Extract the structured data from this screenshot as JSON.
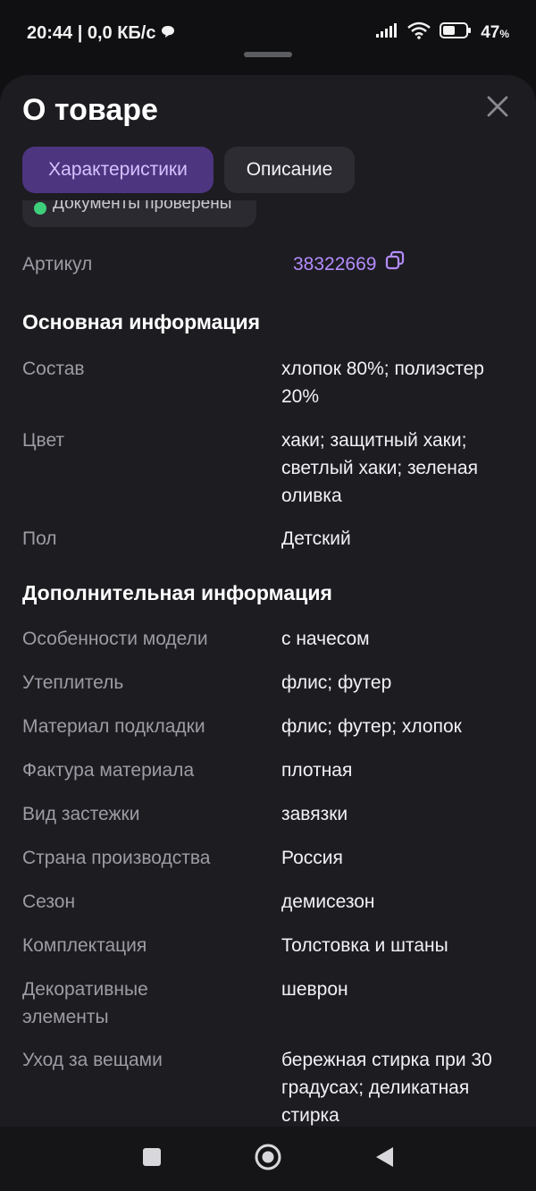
{
  "status_bar": {
    "time_speed": "20:44 | 0,0 КБ/с",
    "battery": "47",
    "battery_unit": "%"
  },
  "sheet": {
    "title": "О товаре",
    "tabs": [
      {
        "label": "Характеристики",
        "active": true
      },
      {
        "label": "Описание",
        "active": false
      }
    ],
    "clipped_badge": "Документы проверены",
    "article": {
      "label": "Артикул",
      "value": "38322669"
    }
  },
  "sections": [
    {
      "title": "Основная информация",
      "rows": [
        {
          "label": "Состав",
          "value": "хлопок 80%; полиэстер 20%"
        },
        {
          "label": "Цвет",
          "value": "хаки; защитный хаки; светлый хаки; зеленая оливка"
        },
        {
          "label": "Пол",
          "value": "Детский"
        }
      ]
    },
    {
      "title": "Дополнительная информация",
      "rows": [
        {
          "label": "Особенности модели",
          "value": "с начесом"
        },
        {
          "label": "Утеплитель",
          "value": "флис; футер"
        },
        {
          "label": "Материал подкладки",
          "value": "флис; футер; хлопок"
        },
        {
          "label": "Фактура материала",
          "value": "плотная"
        },
        {
          "label": "Вид застежки",
          "value": "завязки"
        },
        {
          "label": "Страна производства",
          "value": "Россия"
        },
        {
          "label": "Сезон",
          "value": "демисезон"
        },
        {
          "label": "Комплектация",
          "value": "Толстовка и штаны"
        },
        {
          "label": "Декоративные элементы",
          "value": "шеврон"
        },
        {
          "label": "Уход за вещами",
          "value": "бережная стирка при 30 градусах; деликатная стирка"
        }
      ]
    }
  ],
  "colors": {
    "accent": "#b48cff",
    "tab_active_bg": "#4d3580",
    "sheet_bg": "#1d1c21",
    "verified_dot": "#3ecf7a"
  },
  "icons": {
    "close": "close-icon",
    "copy": "copy-icon",
    "chat": "chat-bubble-icon",
    "signal": "signal-icon",
    "wifi": "wifi-icon",
    "battery": "battery-icon",
    "nav_recents": "square-icon",
    "nav_home": "circle-icon",
    "nav_back": "triangle-back-icon"
  }
}
